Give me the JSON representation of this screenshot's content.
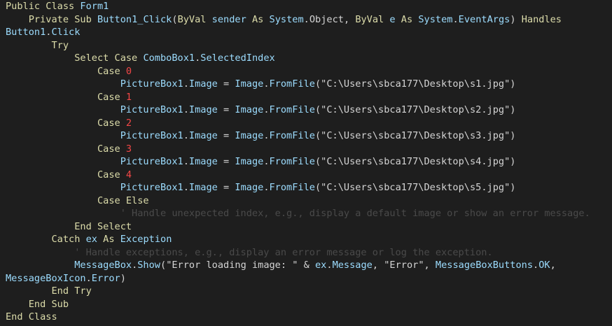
{
  "editor": {
    "lines": [
      [
        {
          "t": "kw",
          "v": "Public Class "
        },
        {
          "t": "id",
          "v": "Form1"
        }
      ],
      [
        {
          "t": "pl",
          "v": "    "
        },
        {
          "t": "kw",
          "v": "Private Sub "
        },
        {
          "t": "id",
          "v": "Button1_Click"
        },
        {
          "t": "pl",
          "v": "("
        },
        {
          "t": "kw",
          "v": "ByVal "
        },
        {
          "t": "id",
          "v": "sender "
        },
        {
          "t": "kw",
          "v": "As "
        },
        {
          "t": "id",
          "v": "System"
        },
        {
          "t": "pl",
          "v": "."
        },
        {
          "t": "pl",
          "v": "Object"
        },
        {
          "t": "pl",
          "v": ", "
        },
        {
          "t": "kw",
          "v": "ByVal "
        },
        {
          "t": "id",
          "v": "e "
        },
        {
          "t": "kw",
          "v": "As "
        },
        {
          "t": "id",
          "v": "System"
        },
        {
          "t": "pl",
          "v": "."
        },
        {
          "t": "id",
          "v": "EventArgs"
        },
        {
          "t": "pl",
          "v": ") "
        },
        {
          "t": "kw",
          "v": "Handles"
        }
      ],
      [
        {
          "t": "id",
          "v": "Button1"
        },
        {
          "t": "pl",
          "v": "."
        },
        {
          "t": "id",
          "v": "Click"
        }
      ],
      [
        {
          "t": "pl",
          "v": "        "
        },
        {
          "t": "kw",
          "v": "Try"
        }
      ],
      [
        {
          "t": "pl",
          "v": "            "
        },
        {
          "t": "kw",
          "v": "Select Case "
        },
        {
          "t": "id",
          "v": "ComboBox1"
        },
        {
          "t": "pl",
          "v": "."
        },
        {
          "t": "id",
          "v": "SelectedIndex"
        }
      ],
      [
        {
          "t": "pl",
          "v": "                "
        },
        {
          "t": "kw",
          "v": "Case "
        },
        {
          "t": "num",
          "v": "0"
        }
      ],
      [
        {
          "t": "pl",
          "v": "                    "
        },
        {
          "t": "id",
          "v": "PictureBox1"
        },
        {
          "t": "pl",
          "v": "."
        },
        {
          "t": "id",
          "v": "Image"
        },
        {
          "t": "pl",
          "v": " = "
        },
        {
          "t": "id",
          "v": "Image"
        },
        {
          "t": "pl",
          "v": "."
        },
        {
          "t": "id",
          "v": "FromFile"
        },
        {
          "t": "pl",
          "v": "("
        },
        {
          "t": "st",
          "v": "\"C:\\Users\\sbca177\\Desktop\\s1.jpg\""
        },
        {
          "t": "pl",
          "v": ")"
        }
      ],
      [
        {
          "t": "pl",
          "v": "                "
        },
        {
          "t": "kw",
          "v": "Case "
        },
        {
          "t": "num",
          "v": "1"
        }
      ],
      [
        {
          "t": "pl",
          "v": "                    "
        },
        {
          "t": "id",
          "v": "PictureBox1"
        },
        {
          "t": "pl",
          "v": "."
        },
        {
          "t": "id",
          "v": "Image"
        },
        {
          "t": "pl",
          "v": " = "
        },
        {
          "t": "id",
          "v": "Image"
        },
        {
          "t": "pl",
          "v": "."
        },
        {
          "t": "id",
          "v": "FromFile"
        },
        {
          "t": "pl",
          "v": "("
        },
        {
          "t": "st",
          "v": "\"C:\\Users\\sbca177\\Desktop\\s2.jpg\""
        },
        {
          "t": "pl",
          "v": ")"
        }
      ],
      [
        {
          "t": "pl",
          "v": "                "
        },
        {
          "t": "kw",
          "v": "Case "
        },
        {
          "t": "num",
          "v": "2"
        }
      ],
      [
        {
          "t": "pl",
          "v": "                    "
        },
        {
          "t": "id",
          "v": "PictureBox1"
        },
        {
          "t": "pl",
          "v": "."
        },
        {
          "t": "id",
          "v": "Image"
        },
        {
          "t": "pl",
          "v": " = "
        },
        {
          "t": "id",
          "v": "Image"
        },
        {
          "t": "pl",
          "v": "."
        },
        {
          "t": "id",
          "v": "FromFile"
        },
        {
          "t": "pl",
          "v": "("
        },
        {
          "t": "st",
          "v": "\"C:\\Users\\sbca177\\Desktop\\s3.jpg\""
        },
        {
          "t": "pl",
          "v": ")"
        }
      ],
      [
        {
          "t": "pl",
          "v": "                "
        },
        {
          "t": "kw",
          "v": "Case "
        },
        {
          "t": "num",
          "v": "3"
        }
      ],
      [
        {
          "t": "pl",
          "v": "                    "
        },
        {
          "t": "id",
          "v": "PictureBox1"
        },
        {
          "t": "pl",
          "v": "."
        },
        {
          "t": "id",
          "v": "Image"
        },
        {
          "t": "pl",
          "v": " = "
        },
        {
          "t": "id",
          "v": "Image"
        },
        {
          "t": "pl",
          "v": "."
        },
        {
          "t": "id",
          "v": "FromFile"
        },
        {
          "t": "pl",
          "v": "("
        },
        {
          "t": "st",
          "v": "\"C:\\Users\\sbca177\\Desktop\\s4.jpg\""
        },
        {
          "t": "pl",
          "v": ")"
        }
      ],
      [
        {
          "t": "pl",
          "v": "                "
        },
        {
          "t": "kw",
          "v": "Case "
        },
        {
          "t": "num",
          "v": "4"
        }
      ],
      [
        {
          "t": "pl",
          "v": "                    "
        },
        {
          "t": "id",
          "v": "PictureBox1"
        },
        {
          "t": "pl",
          "v": "."
        },
        {
          "t": "id",
          "v": "Image"
        },
        {
          "t": "pl",
          "v": " = "
        },
        {
          "t": "id",
          "v": "Image"
        },
        {
          "t": "pl",
          "v": "."
        },
        {
          "t": "id",
          "v": "FromFile"
        },
        {
          "t": "pl",
          "v": "("
        },
        {
          "t": "st",
          "v": "\"C:\\Users\\sbca177\\Desktop\\s5.jpg\""
        },
        {
          "t": "pl",
          "v": ")"
        }
      ],
      [
        {
          "t": "pl",
          "v": "                "
        },
        {
          "t": "kw",
          "v": "Case Else"
        }
      ],
      [
        {
          "t": "pl",
          "v": "                    "
        },
        {
          "t": "cm",
          "v": "' Handle unexpected index, e.g., display a default image or show an error message."
        }
      ],
      [
        {
          "t": "pl",
          "v": "            "
        },
        {
          "t": "kw",
          "v": "End Select"
        }
      ],
      [
        {
          "t": "pl",
          "v": "        "
        },
        {
          "t": "kw",
          "v": "Catch "
        },
        {
          "t": "id",
          "v": "ex "
        },
        {
          "t": "kw",
          "v": "As "
        },
        {
          "t": "id",
          "v": "Exception"
        }
      ],
      [
        {
          "t": "pl",
          "v": "            "
        },
        {
          "t": "cm",
          "v": "' Handle exceptions, e.g., display an error message or log the exception."
        }
      ],
      [
        {
          "t": "pl",
          "v": "            "
        },
        {
          "t": "id",
          "v": "MessageBox"
        },
        {
          "t": "pl",
          "v": "."
        },
        {
          "t": "id",
          "v": "Show"
        },
        {
          "t": "pl",
          "v": "("
        },
        {
          "t": "st",
          "v": "\"Error loading image: \""
        },
        {
          "t": "pl",
          "v": " & "
        },
        {
          "t": "id",
          "v": "ex"
        },
        {
          "t": "pl",
          "v": "."
        },
        {
          "t": "id",
          "v": "Message"
        },
        {
          "t": "pl",
          "v": ", "
        },
        {
          "t": "st",
          "v": "\"Error\""
        },
        {
          "t": "pl",
          "v": ", "
        },
        {
          "t": "id",
          "v": "MessageBoxButtons"
        },
        {
          "t": "pl",
          "v": "."
        },
        {
          "t": "id",
          "v": "OK"
        },
        {
          "t": "pl",
          "v": ","
        }
      ],
      [
        {
          "t": "id",
          "v": "MessageBoxIcon"
        },
        {
          "t": "pl",
          "v": "."
        },
        {
          "t": "id",
          "v": "Error"
        },
        {
          "t": "pl",
          "v": ")"
        }
      ],
      [
        {
          "t": "pl",
          "v": "        "
        },
        {
          "t": "kw",
          "v": "End Try"
        }
      ],
      [
        {
          "t": "pl",
          "v": "    "
        },
        {
          "t": "kw",
          "v": "End Sub"
        }
      ],
      [
        {
          "t": "kw",
          "v": "End Class"
        }
      ]
    ]
  },
  "colors": {
    "background": "#1e1e1e",
    "keyword": "#dcdcaa",
    "identifier": "#9cdcfe",
    "string": "#d4d4d4",
    "number": "#f44747",
    "comment": "#4a4a4a"
  }
}
